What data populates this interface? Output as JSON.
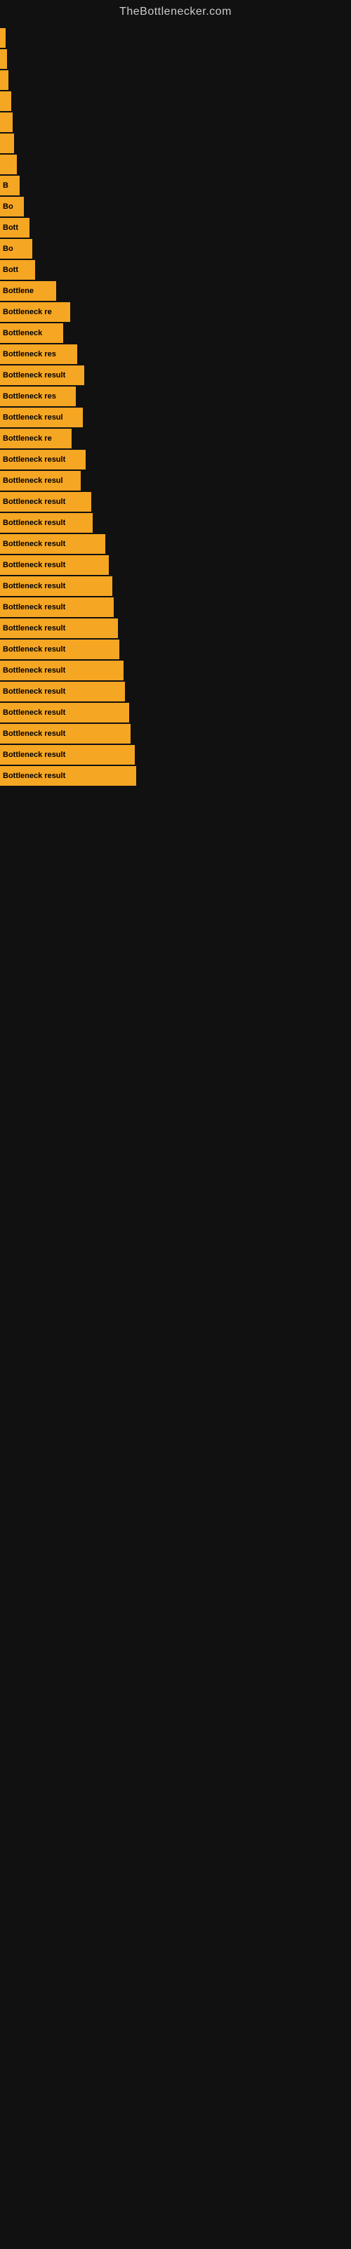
{
  "site": {
    "title": "TheBottlenecker.com"
  },
  "bars": [
    {
      "id": 1,
      "width": 8,
      "label": ""
    },
    {
      "id": 2,
      "width": 10,
      "label": ""
    },
    {
      "id": 3,
      "width": 12,
      "label": ""
    },
    {
      "id": 4,
      "width": 16,
      "label": ""
    },
    {
      "id": 5,
      "width": 18,
      "label": ""
    },
    {
      "id": 6,
      "width": 20,
      "label": ""
    },
    {
      "id": 7,
      "width": 24,
      "label": ""
    },
    {
      "id": 8,
      "width": 28,
      "label": "B"
    },
    {
      "id": 9,
      "width": 34,
      "label": "Bo"
    },
    {
      "id": 10,
      "width": 42,
      "label": "Bott"
    },
    {
      "id": 11,
      "width": 46,
      "label": "Bo"
    },
    {
      "id": 12,
      "width": 50,
      "label": "Bott"
    },
    {
      "id": 13,
      "width": 80,
      "label": "Bottlene"
    },
    {
      "id": 14,
      "width": 100,
      "label": "Bottleneck re"
    },
    {
      "id": 15,
      "width": 90,
      "label": "Bottleneck"
    },
    {
      "id": 16,
      "width": 110,
      "label": "Bottleneck res"
    },
    {
      "id": 17,
      "width": 120,
      "label": "Bottleneck result"
    },
    {
      "id": 18,
      "width": 108,
      "label": "Bottleneck res"
    },
    {
      "id": 19,
      "width": 118,
      "label": "Bottleneck resul"
    },
    {
      "id": 20,
      "width": 102,
      "label": "Bottleneck re"
    },
    {
      "id": 21,
      "width": 122,
      "label": "Bottleneck result"
    },
    {
      "id": 22,
      "width": 115,
      "label": "Bottleneck resul"
    },
    {
      "id": 23,
      "width": 130,
      "label": "Bottleneck result"
    },
    {
      "id": 24,
      "width": 132,
      "label": "Bottleneck result"
    },
    {
      "id": 25,
      "width": 150,
      "label": "Bottleneck result"
    },
    {
      "id": 26,
      "width": 155,
      "label": "Bottleneck result"
    },
    {
      "id": 27,
      "width": 160,
      "label": "Bottleneck result"
    },
    {
      "id": 28,
      "width": 162,
      "label": "Bottleneck result"
    },
    {
      "id": 29,
      "width": 168,
      "label": "Bottleneck result"
    },
    {
      "id": 30,
      "width": 170,
      "label": "Bottleneck result"
    },
    {
      "id": 31,
      "width": 176,
      "label": "Bottleneck result"
    },
    {
      "id": 32,
      "width": 178,
      "label": "Bottleneck result"
    },
    {
      "id": 33,
      "width": 184,
      "label": "Bottleneck result"
    },
    {
      "id": 34,
      "width": 186,
      "label": "Bottleneck result"
    },
    {
      "id": 35,
      "width": 192,
      "label": "Bottleneck result"
    },
    {
      "id": 36,
      "width": 194,
      "label": "Bottleneck result"
    }
  ]
}
